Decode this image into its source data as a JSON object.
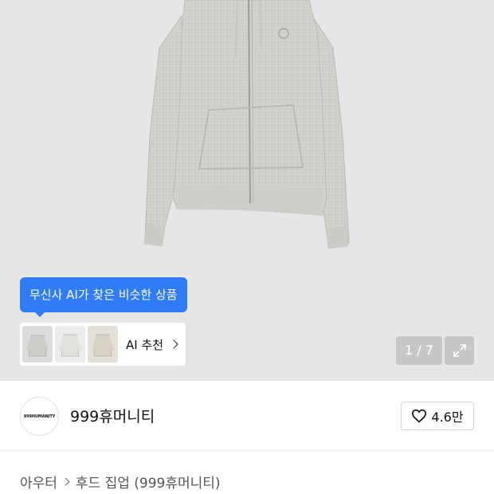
{
  "gallery": {
    "ai_tooltip": "무신사 AI가 찾은 비슷한 상품",
    "ai_recommend_label": "AI 추천",
    "counter": "1 / 7",
    "thumbnails": [
      "hoodie-thumb-1",
      "hoodie-thumb-2",
      "hoodie-thumb-3"
    ],
    "colors": {
      "tooltip": "#2f7cf6",
      "background": "#e6e6e6"
    }
  },
  "brand": {
    "logo_text": "999HUMANITY",
    "name": "999휴머니티",
    "likes": "4.6만",
    "like_icon": "heart-outline-icon"
  },
  "breadcrumb": {
    "category": "아우터",
    "subcategory": "후드 집업 (999휴머니티)"
  }
}
